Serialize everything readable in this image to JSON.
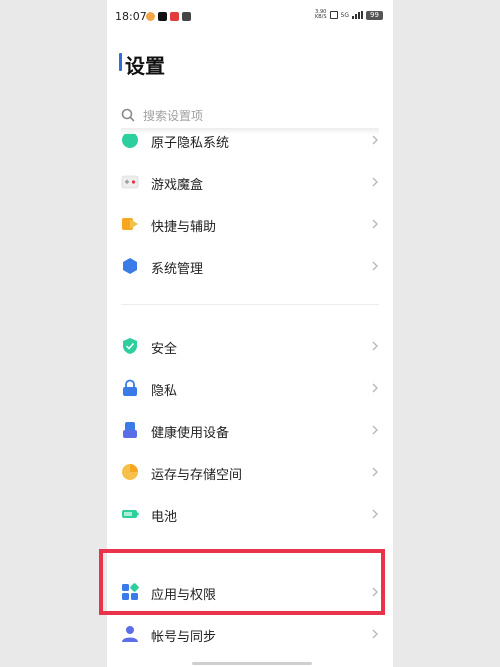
{
  "status_bar": {
    "time": "18:07",
    "net_speed_value": "3.90",
    "net_speed_unit": "KB/S",
    "network": "5G",
    "battery": "99"
  },
  "header": {
    "title": "设置"
  },
  "search": {
    "placeholder": "搜索设置项"
  },
  "groups": [
    {
      "items": [
        {
          "label": "原子隐私系统",
          "icon": "atom-privacy-icon"
        },
        {
          "label": "游戏魔盒",
          "icon": "game-box-icon"
        },
        {
          "label": "快捷与辅助",
          "icon": "shortcut-assist-icon"
        },
        {
          "label": "系统管理",
          "icon": "system-management-icon"
        }
      ]
    },
    {
      "items": [
        {
          "label": "安全",
          "icon": "security-shield-icon"
        },
        {
          "label": "隐私",
          "icon": "privacy-lock-icon"
        },
        {
          "label": "健康使用设备",
          "icon": "healthy-usage-icon"
        },
        {
          "label": "运存与存储空间",
          "icon": "storage-pie-icon"
        },
        {
          "label": "电池",
          "icon": "battery-icon"
        }
      ]
    },
    {
      "items": [
        {
          "label": "应用与权限",
          "icon": "apps-permissions-icon",
          "highlighted": true
        },
        {
          "label": "帐号与同步",
          "icon": "account-sync-icon"
        }
      ]
    }
  ],
  "colors": {
    "highlight_border": "#e8334a",
    "title_accent": "#2f6ed9",
    "teal": "#2ecf9e",
    "blue": "#3b7be8",
    "orange": "#f5a623"
  }
}
